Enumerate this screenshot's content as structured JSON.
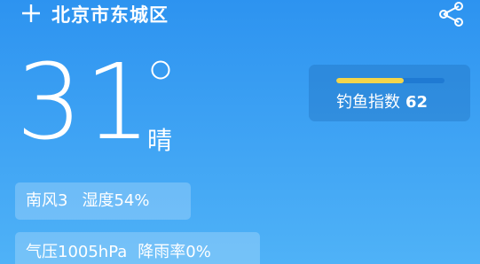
{
  "header": {
    "add_icon": "plus-icon",
    "location": "北京市东城区",
    "share_icon": "share-icon"
  },
  "weather": {
    "temperature": "31",
    "degree_symbol": "°",
    "condition": "晴"
  },
  "fishing_index": {
    "label": "钓鱼指数",
    "value": "62",
    "bar_level": 0.62,
    "bar_fill_color": "#f3d54a",
    "bar_track_color": "#1f7ad3"
  },
  "details": {
    "wind": "南风3",
    "humidity": "湿度54%",
    "pressure": "气压1005hPa",
    "precipitation": "降雨率0%"
  },
  "colors": {
    "background_top": "#2d93f0",
    "background_bottom": "#4fb2f7"
  }
}
